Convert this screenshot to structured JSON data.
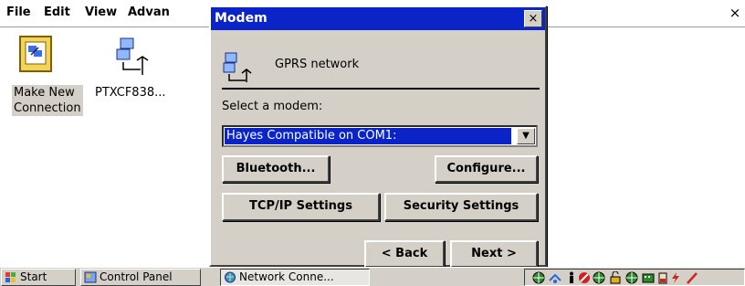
{
  "background_window": {
    "menu": [
      "File",
      "Edit",
      "View",
      "Advan"
    ],
    "icons": [
      {
        "label_line1": "Make New",
        "label_line2": "Connection",
        "icon": "make-new-connection-icon"
      },
      {
        "label_line1": "PTXCF838...",
        "label_line2": "",
        "icon": "network-connection-icon"
      }
    ],
    "close_glyph": "×"
  },
  "dialog": {
    "title": "Modem",
    "close_glyph": "×",
    "connection_name": "GPRS network",
    "select_label": "Select a modem:",
    "selected_modem": "Hayes Compatible on COM1:",
    "buttons": {
      "bluetooth": "Bluetooth...",
      "configure": "Configure...",
      "tcpip": "TCP/IP Settings",
      "security": "Security Settings",
      "back": "< Back",
      "next": "Next >"
    }
  },
  "taskbar": {
    "start": "Start",
    "control_panel": "Control Panel",
    "network_connections": "Network Conne..."
  },
  "colors": {
    "title_bar": "#0a24c8",
    "dialog_face": "#d4d0c8",
    "selection": "#0a24c8"
  }
}
